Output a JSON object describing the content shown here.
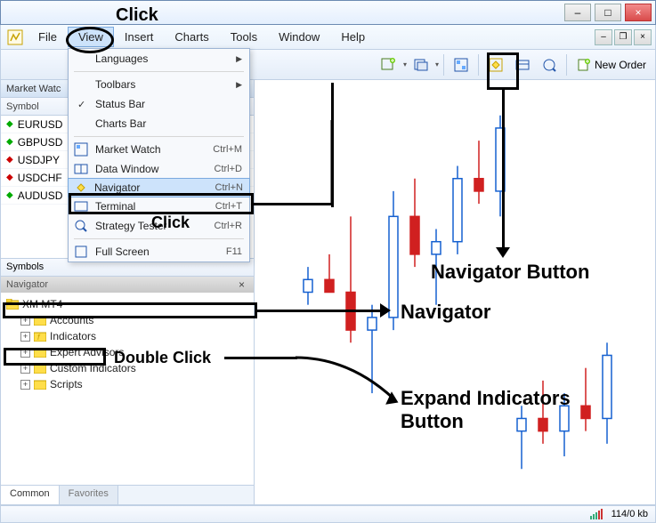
{
  "window": {
    "minimize": "–",
    "maximize": "□",
    "close": "×"
  },
  "menu": {
    "file": "File",
    "view": "View",
    "insert": "Insert",
    "charts": "Charts",
    "tools": "Tools",
    "window": "Window",
    "help": "Help"
  },
  "view_dropdown": {
    "languages": "Languages",
    "toolbars": "Toolbars",
    "status_bar": "Status Bar",
    "charts_bar": "Charts Bar",
    "market_watch": "Market Watch",
    "market_watch_sc": "Ctrl+M",
    "data_window": "Data Window",
    "data_window_sc": "Ctrl+D",
    "navigator": "Navigator",
    "navigator_sc": "Ctrl+N",
    "terminal": "Terminal",
    "terminal_sc": "Ctrl+T",
    "strategy_tester": "Strategy Tester",
    "strategy_tester_sc": "Ctrl+R",
    "full_screen": "Full Screen",
    "full_screen_sc": "F11"
  },
  "toolbar": {
    "new_order": "New Order"
  },
  "market_watch": {
    "title": "Market Watc",
    "col_symbol": "Symbol",
    "rows": [
      {
        "dir": "up",
        "sym": "EURUSD"
      },
      {
        "dir": "up",
        "sym": "GBPUSD"
      },
      {
        "dir": "dn",
        "sym": "USDJPY"
      },
      {
        "dir": "dn",
        "sym": "USDCHF"
      },
      {
        "dir": "up",
        "sym": "AUDUSD"
      }
    ],
    "footer": "Symbols"
  },
  "navigator": {
    "title": "Navigator",
    "close": "×",
    "root": "XM MT4",
    "accounts": "Accounts",
    "indicators": "Indicators",
    "expert_advisors": "Expert Advisors",
    "custom_indicators": "Custom Indicators",
    "scripts": "Scripts",
    "tab_common": "Common",
    "tab_favorites": "Favorites"
  },
  "annotations": {
    "click_top": "Click",
    "click_nav": "Click",
    "double_click": "Double Click",
    "navigator_button": "Navigator Button",
    "navigator_label": "Navigator",
    "expand_label": "Expand Indicators\nButton"
  },
  "status": {
    "conn": "114/0 kb"
  },
  "chart_data": {
    "type": "candlestick",
    "series": [
      {
        "o": 1.06,
        "h": 1.08,
        "l": 1.05,
        "c": 1.07,
        "dir": "up"
      },
      {
        "o": 1.07,
        "h": 1.09,
        "l": 1.06,
        "c": 1.06,
        "dir": "dn"
      },
      {
        "o": 1.06,
        "h": 1.12,
        "l": 1.02,
        "c": 1.03,
        "dir": "dn"
      },
      {
        "o": 1.03,
        "h": 1.05,
        "l": 0.98,
        "c": 1.04,
        "dir": "up"
      },
      {
        "o": 1.04,
        "h": 1.14,
        "l": 1.03,
        "c": 1.12,
        "dir": "up"
      },
      {
        "o": 1.12,
        "h": 1.15,
        "l": 1.08,
        "c": 1.09,
        "dir": "dn"
      },
      {
        "o": 1.09,
        "h": 1.11,
        "l": 1.05,
        "c": 1.1,
        "dir": "up"
      },
      {
        "o": 1.1,
        "h": 1.16,
        "l": 1.09,
        "c": 1.15,
        "dir": "up"
      },
      {
        "o": 1.15,
        "h": 1.18,
        "l": 1.13,
        "c": 1.14,
        "dir": "dn"
      },
      {
        "o": 1.14,
        "h": 1.2,
        "l": 1.12,
        "c": 1.19,
        "dir": "up"
      },
      {
        "o": 0.95,
        "h": 0.97,
        "l": 0.92,
        "c": 0.96,
        "dir": "up"
      },
      {
        "o": 0.96,
        "h": 0.99,
        "l": 0.94,
        "c": 0.95,
        "dir": "dn"
      },
      {
        "o": 0.95,
        "h": 0.98,
        "l": 0.93,
        "c": 0.97,
        "dir": "up"
      },
      {
        "o": 0.97,
        "h": 1.0,
        "l": 0.95,
        "c": 0.96,
        "dir": "dn"
      },
      {
        "o": 0.96,
        "h": 1.02,
        "l": 0.94,
        "c": 1.01,
        "dir": "up"
      }
    ]
  }
}
